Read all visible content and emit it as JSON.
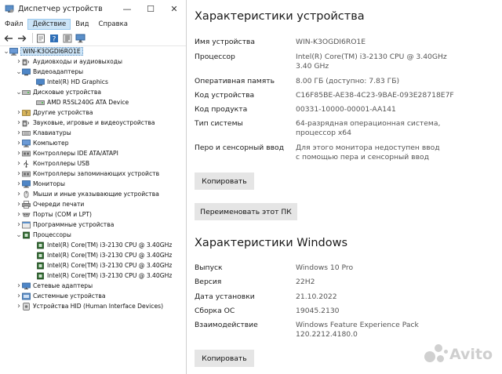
{
  "device_manager": {
    "title": "Диспетчер устройств",
    "window_controls": {
      "minimize": "—",
      "maximize": "☐",
      "close": "✕"
    },
    "menu": [
      "Файл",
      "Действие",
      "Вид",
      "Справка"
    ],
    "tree": [
      {
        "label": "WIN-K3OGDI6RO1E",
        "level": 0,
        "expander": "v",
        "icon": "computer-icon",
        "root": true
      },
      {
        "label": "Аудиовходы и аудиовыходы",
        "level": 1,
        "expander": ">",
        "icon": "speaker-icon"
      },
      {
        "label": "Видеоадаптеры",
        "level": 1,
        "expander": "v",
        "icon": "display-adapter-icon"
      },
      {
        "label": "Intel(R) HD Graphics",
        "level": 2,
        "expander": "",
        "icon": "display-adapter-icon"
      },
      {
        "label": "Дисковые устройства",
        "level": 1,
        "expander": "v",
        "icon": "disk-icon"
      },
      {
        "label": "AMD R5SL240G ATA Device",
        "level": 2,
        "expander": "",
        "icon": "disk-icon"
      },
      {
        "label": "Другие устройства",
        "level": 1,
        "expander": ">",
        "icon": "unknown-device-icon"
      },
      {
        "label": "Звуковые, игровые и видеоустройства",
        "level": 1,
        "expander": ">",
        "icon": "speaker-icon"
      },
      {
        "label": "Клавиатуры",
        "level": 1,
        "expander": ">",
        "icon": "keyboard-icon"
      },
      {
        "label": "Компьютер",
        "level": 1,
        "expander": ">",
        "icon": "computer-icon"
      },
      {
        "label": "Контроллеры IDE ATA/ATAPI",
        "level": 1,
        "expander": ">",
        "icon": "controller-icon"
      },
      {
        "label": "Контроллеры USB",
        "level": 1,
        "expander": ">",
        "icon": "usb-icon"
      },
      {
        "label": "Контроллеры запоминающих устройств",
        "level": 1,
        "expander": ">",
        "icon": "controller-icon"
      },
      {
        "label": "Мониторы",
        "level": 1,
        "expander": ">",
        "icon": "monitor-icon"
      },
      {
        "label": "Мыши и иные указывающие устройства",
        "level": 1,
        "expander": ">",
        "icon": "mouse-icon"
      },
      {
        "label": "Очереди печати",
        "level": 1,
        "expander": ">",
        "icon": "printer-icon"
      },
      {
        "label": "Порты (COM и LPT)",
        "level": 1,
        "expander": ">",
        "icon": "port-icon"
      },
      {
        "label": "Программные устройства",
        "level": 1,
        "expander": ">",
        "icon": "software-device-icon"
      },
      {
        "label": "Процессоры",
        "level": 1,
        "expander": "v",
        "icon": "processor-icon"
      },
      {
        "label": "Intel(R) Core(TM) i3-2130 CPU @ 3.40GHz",
        "level": 2,
        "expander": "",
        "icon": "processor-icon"
      },
      {
        "label": "Intel(R) Core(TM) i3-2130 CPU @ 3.40GHz",
        "level": 2,
        "expander": "",
        "icon": "processor-icon"
      },
      {
        "label": "Intel(R) Core(TM) i3-2130 CPU @ 3.40GHz",
        "level": 2,
        "expander": "",
        "icon": "processor-icon"
      },
      {
        "label": "Intel(R) Core(TM) i3-2130 CPU @ 3.40GHz",
        "level": 2,
        "expander": "",
        "icon": "processor-icon"
      },
      {
        "label": "Сетевые адаптеры",
        "level": 1,
        "expander": ">",
        "icon": "network-adapter-icon"
      },
      {
        "label": "Системные устройства",
        "level": 1,
        "expander": ">",
        "icon": "system-device-icon"
      },
      {
        "label": "Устройства HID (Human Interface Devices)",
        "level": 1,
        "expander": ">",
        "icon": "hid-icon"
      }
    ]
  },
  "device_specs": {
    "heading": "Характеристики устройства",
    "rows": [
      {
        "key": "Имя устройства",
        "value": "WIN-K3OGDI6RO1E"
      },
      {
        "key": "Процессор",
        "value": "Intel(R) Core(TM) i3-2130 CPU @ 3.40GHz\n3.40 GHz"
      },
      {
        "key": "Оперативная память",
        "value": "8.00 ГБ (доступно: 7.83 ГБ)"
      },
      {
        "key": "Код устройства",
        "value": "C16F85BE-AE38-4C23-9BAE-093E28718E7F"
      },
      {
        "key": "Код продукта",
        "value": "00331-10000-00001-AA141"
      },
      {
        "key": "Тип системы",
        "value": "64-разрядная операционная система, процессор x64"
      },
      {
        "key": "Перо и сенсорный ввод",
        "value": "Для этого монитора недоступен ввод с помощью пера и сенсорный ввод"
      }
    ],
    "copy_button": "Копировать",
    "rename_button": "Переименовать этот ПК"
  },
  "windows_specs": {
    "heading": "Характеристики Windows",
    "rows": [
      {
        "key": "Выпуск",
        "value": "Windows 10 Pro"
      },
      {
        "key": "Версия",
        "value": "22H2"
      },
      {
        "key": "Дата установки",
        "value": "21.10.2022"
      },
      {
        "key": "Сборка ОС",
        "value": "19045.2130"
      },
      {
        "key": "Взаимодействие",
        "value": "Windows Feature Experience Pack\n120.2212.4180.0"
      }
    ],
    "copy_button": "Копировать"
  },
  "watermark": "Avito"
}
